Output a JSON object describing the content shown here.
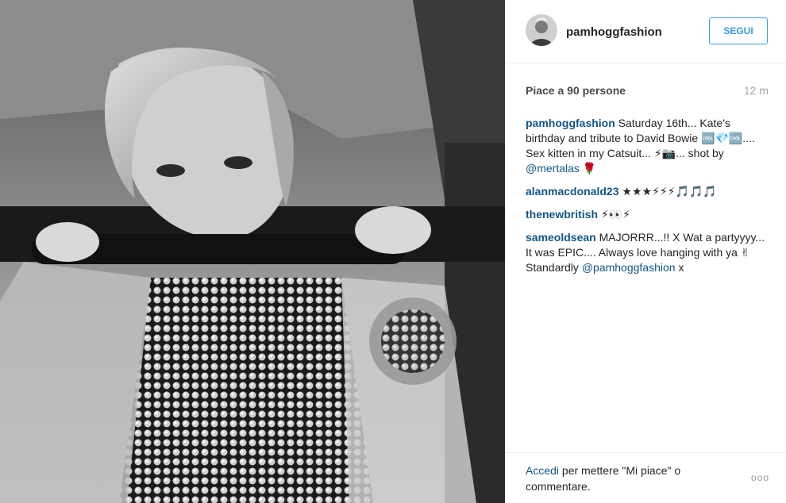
{
  "post": {
    "image_alt": "black and white photo of a woman biting a clothing rail"
  },
  "header": {
    "username": "pamhoggfashion",
    "follow_label": "SEGUI"
  },
  "stats": {
    "likes": "Piace a 90 persone",
    "time": "12 m"
  },
  "comments": [
    {
      "user": "pamhoggfashion",
      "text_before": " Saturday 16th... Kate's birthday and tribute to David Bowie 🆒💎🆒.... Sex kitten in my Catsuit... ⚡📷... shot by ",
      "mention": "@mertalas",
      "text_after": " 🌹"
    },
    {
      "user": "alanmacdonald23",
      "text": " ★★★⚡⚡⚡🎵🎵🎵"
    },
    {
      "user": "thenewbritish",
      "text": " ⚡👀⚡"
    },
    {
      "user": "sameoldsean",
      "text": " MAJORRR...!! X Wat a partyyyy... It was EPIC.... Always love hanging with ya ✌ Standardly ",
      "mention": "@pamhoggfashion",
      "text_after": " x"
    }
  ],
  "footer": {
    "login_link": "Accedi",
    "login_text": " per mettere \"Mi piace\" o commentare.",
    "more_label": "ooo"
  },
  "colors": {
    "link": "#125688",
    "follow_blue": "#3897f0",
    "muted": "#a5a7aa"
  }
}
